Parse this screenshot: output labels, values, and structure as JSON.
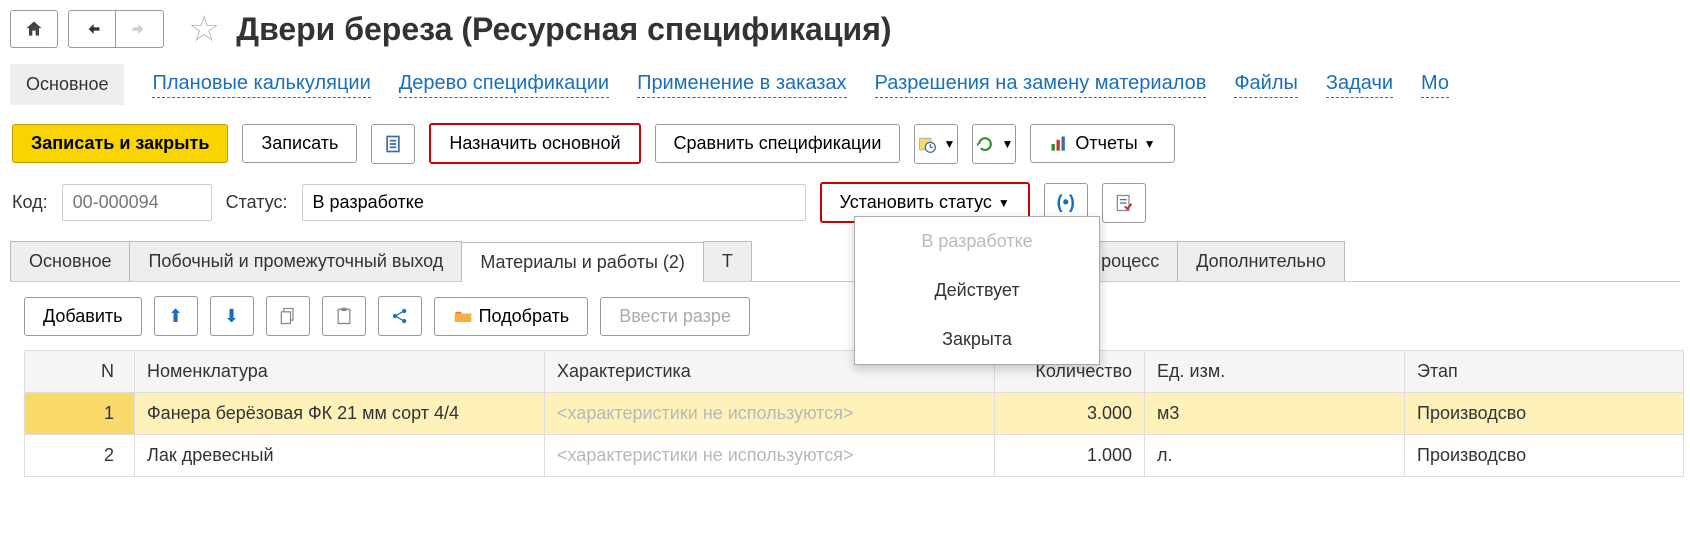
{
  "page_title": "Двери береза (Ресурсная спецификация)",
  "link_tabs": {
    "main": "Основное",
    "plan_calc": "Плановые калькуляции",
    "spec_tree": "Дерево спецификации",
    "usage": "Применение в заказах",
    "replace_perm": "Разрешения на замену материалов",
    "files": "Файлы",
    "tasks": "Задачи",
    "more": "Мо"
  },
  "toolbar": {
    "save_close": "Записать и закрыть",
    "save": "Записать",
    "set_main": "Назначить основной",
    "compare": "Сравнить спецификации",
    "reports": "Отчеты"
  },
  "fields": {
    "code_label": "Код:",
    "code_value": "00-000094",
    "status_label": "Статус:",
    "status_value": "В разработке",
    "set_status": "Установить статус"
  },
  "status_menu": {
    "in_dev": "В разработке",
    "active": "Действует",
    "closed": "Закрыта"
  },
  "subtabs": {
    "main": "Основное",
    "byproduct": "Побочный и промежуточный выход",
    "materials": "Материалы и работы (2)",
    "t_stub": "Т",
    "process": "твенный процесс",
    "extra": "Дополнительно"
  },
  "sub_toolbar": {
    "add": "Добавить",
    "pick": "Подобрать",
    "enter_perm": "Ввести разре"
  },
  "table": {
    "headers": {
      "n": "N",
      "nom": "Номенклатура",
      "char": "Характеристика",
      "qty": "Количество",
      "unit": "Ед. изм.",
      "stage": "Этап"
    },
    "rows": [
      {
        "n": "1",
        "nom": "Фанера берёзовая ФК 21 мм сорт 4/4",
        "char": "<характеристики не используются>",
        "qty": "3.000",
        "unit": "м3",
        "stage": "Производсво"
      },
      {
        "n": "2",
        "nom": "Лак древесный",
        "char": "<характеристики не используются>",
        "qty": "1.000",
        "unit": "л.",
        "stage": "Производсво"
      }
    ]
  }
}
